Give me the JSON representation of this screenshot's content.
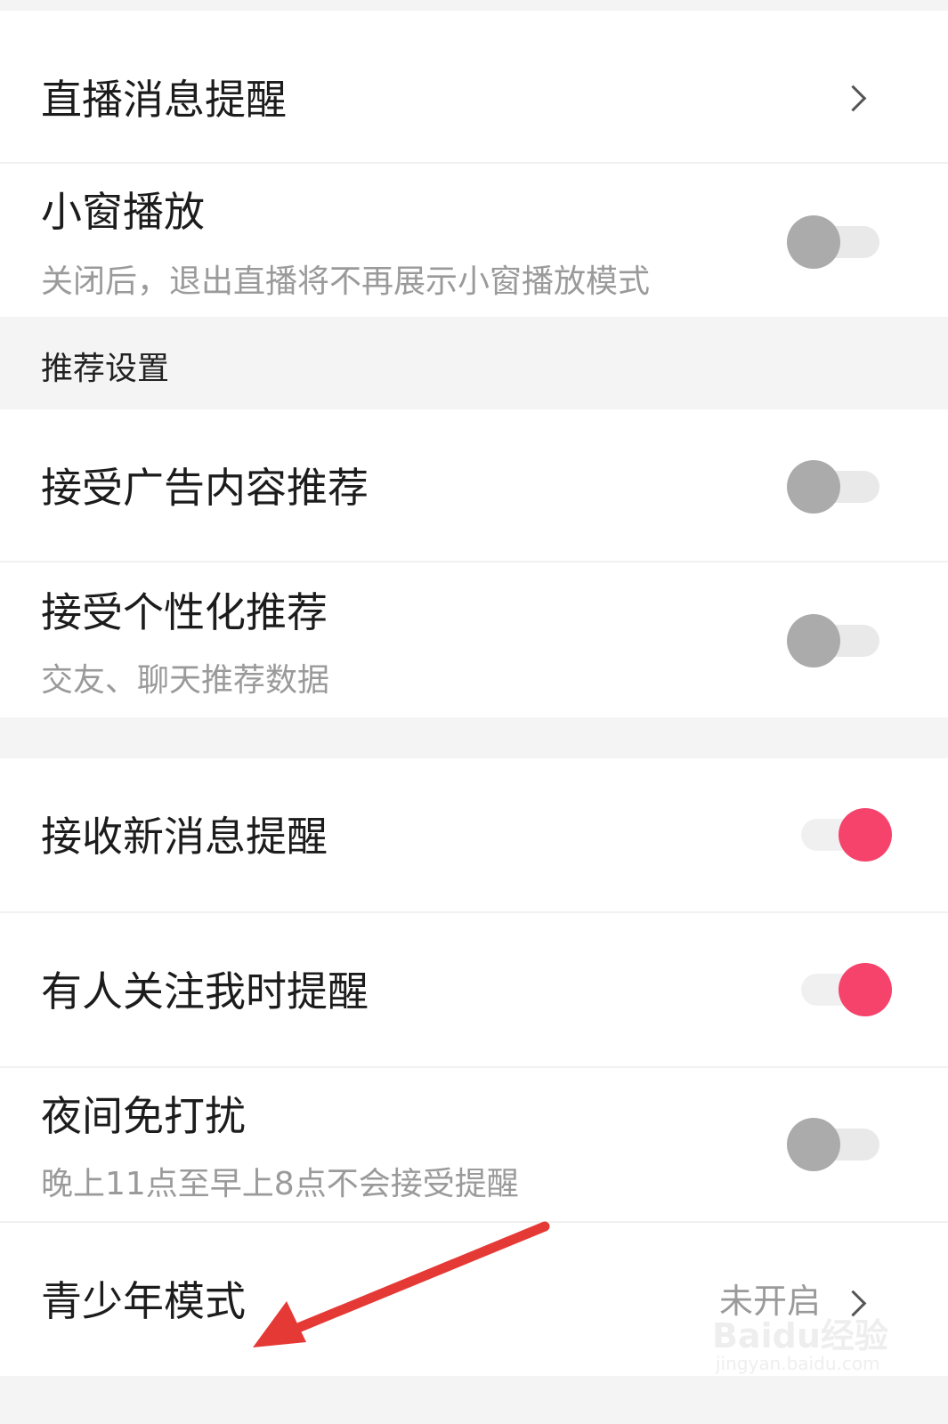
{
  "rows": {
    "live_message_reminder": {
      "label": "直播消息提醒"
    },
    "mini_window_play": {
      "label": "小窗播放",
      "description": "关闭后，退出直播将不再展示小窗播放模式",
      "enabled": false
    },
    "recommend_section": {
      "title": "推荐设置"
    },
    "accept_ad_recommend": {
      "label": "接受广告内容推荐",
      "enabled": false
    },
    "accept_personalized_recommend": {
      "label": "接受个性化推荐",
      "description": "交友、聊天推荐数据",
      "enabled": false
    },
    "new_message_reminder": {
      "label": "接收新消息提醒",
      "enabled": true
    },
    "follow_reminder": {
      "label": "有人关注我时提醒",
      "enabled": true
    },
    "night_do_not_disturb": {
      "label": "夜间免打扰",
      "description": "晚上11点至早上8点不会接受提醒",
      "enabled": false
    },
    "teen_mode": {
      "label": "青少年模式",
      "value": "未开启"
    }
  },
  "annotation": {
    "arrow_color": "#e53935"
  },
  "watermark": {
    "logo": "Baidu经验",
    "url": "jingyan.baidu.com"
  },
  "colors": {
    "switch_on": "#f6436c",
    "switch_off_knob": "#ababab",
    "switch_track": "#e9e9e9",
    "subtext": "#9a9a9a",
    "section_bg": "#f4f4f4"
  }
}
